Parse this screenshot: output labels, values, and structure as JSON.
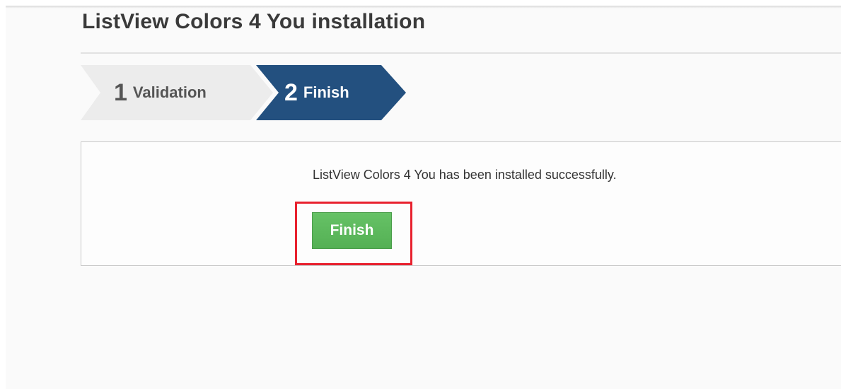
{
  "page": {
    "title": "ListView Colors 4 You installation"
  },
  "wizard": {
    "steps": [
      {
        "number": "1",
        "label": "Validation",
        "state": "inactive"
      },
      {
        "number": "2",
        "label": "Finish",
        "state": "active"
      }
    ],
    "active_color": "#23507f",
    "inactive_color": "#ececec"
  },
  "result": {
    "message": "ListView Colors 4 You has been installed successfully.",
    "finish_button_label": "Finish",
    "button_color": "#5cb85c",
    "highlight_color": "#e8212e"
  }
}
